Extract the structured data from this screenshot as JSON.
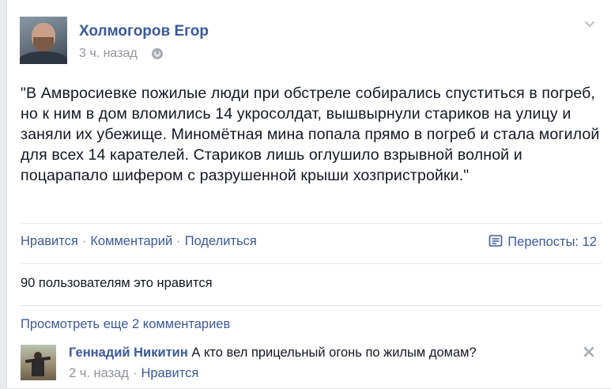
{
  "post": {
    "author": "Холмогоров Егор",
    "time": "3 ч. назад",
    "text": "\"В Амвросиевке пожилые люди при обстреле собирались спуститься в погреб, но к ним в дом вломились 14 укросолдат, вышвырнули стариков на улицу и заняли их убежище. Миномётная мина попала прямо в погреб и стала могилой для всех 14 карателей. Стариков лишь оглушило взрывной волной и поцарапало шифером с разрушенной крыши хозпристройки.\"",
    "icons": {
      "privacy": "globe-icon",
      "options": "chevron-down-icon"
    }
  },
  "actions": {
    "like": "Нравится",
    "comment": "Комментарий",
    "share": "Поделиться",
    "separator": "·",
    "reposts_label": "Перепосты: 12"
  },
  "likes_summary": "90 пользователям это нравится",
  "view_more_comments": "Просмотреть еще 2 комментариев",
  "comment": {
    "author": "Геннадий Никитин",
    "text": "А кто вел прицельный огонь по жилым домам?",
    "time": "2 ч. назад",
    "like": "Нравится"
  },
  "colors": {
    "link": "#3b5998",
    "text": "#141823",
    "muted": "#90949c",
    "background": "#e9ebee"
  }
}
